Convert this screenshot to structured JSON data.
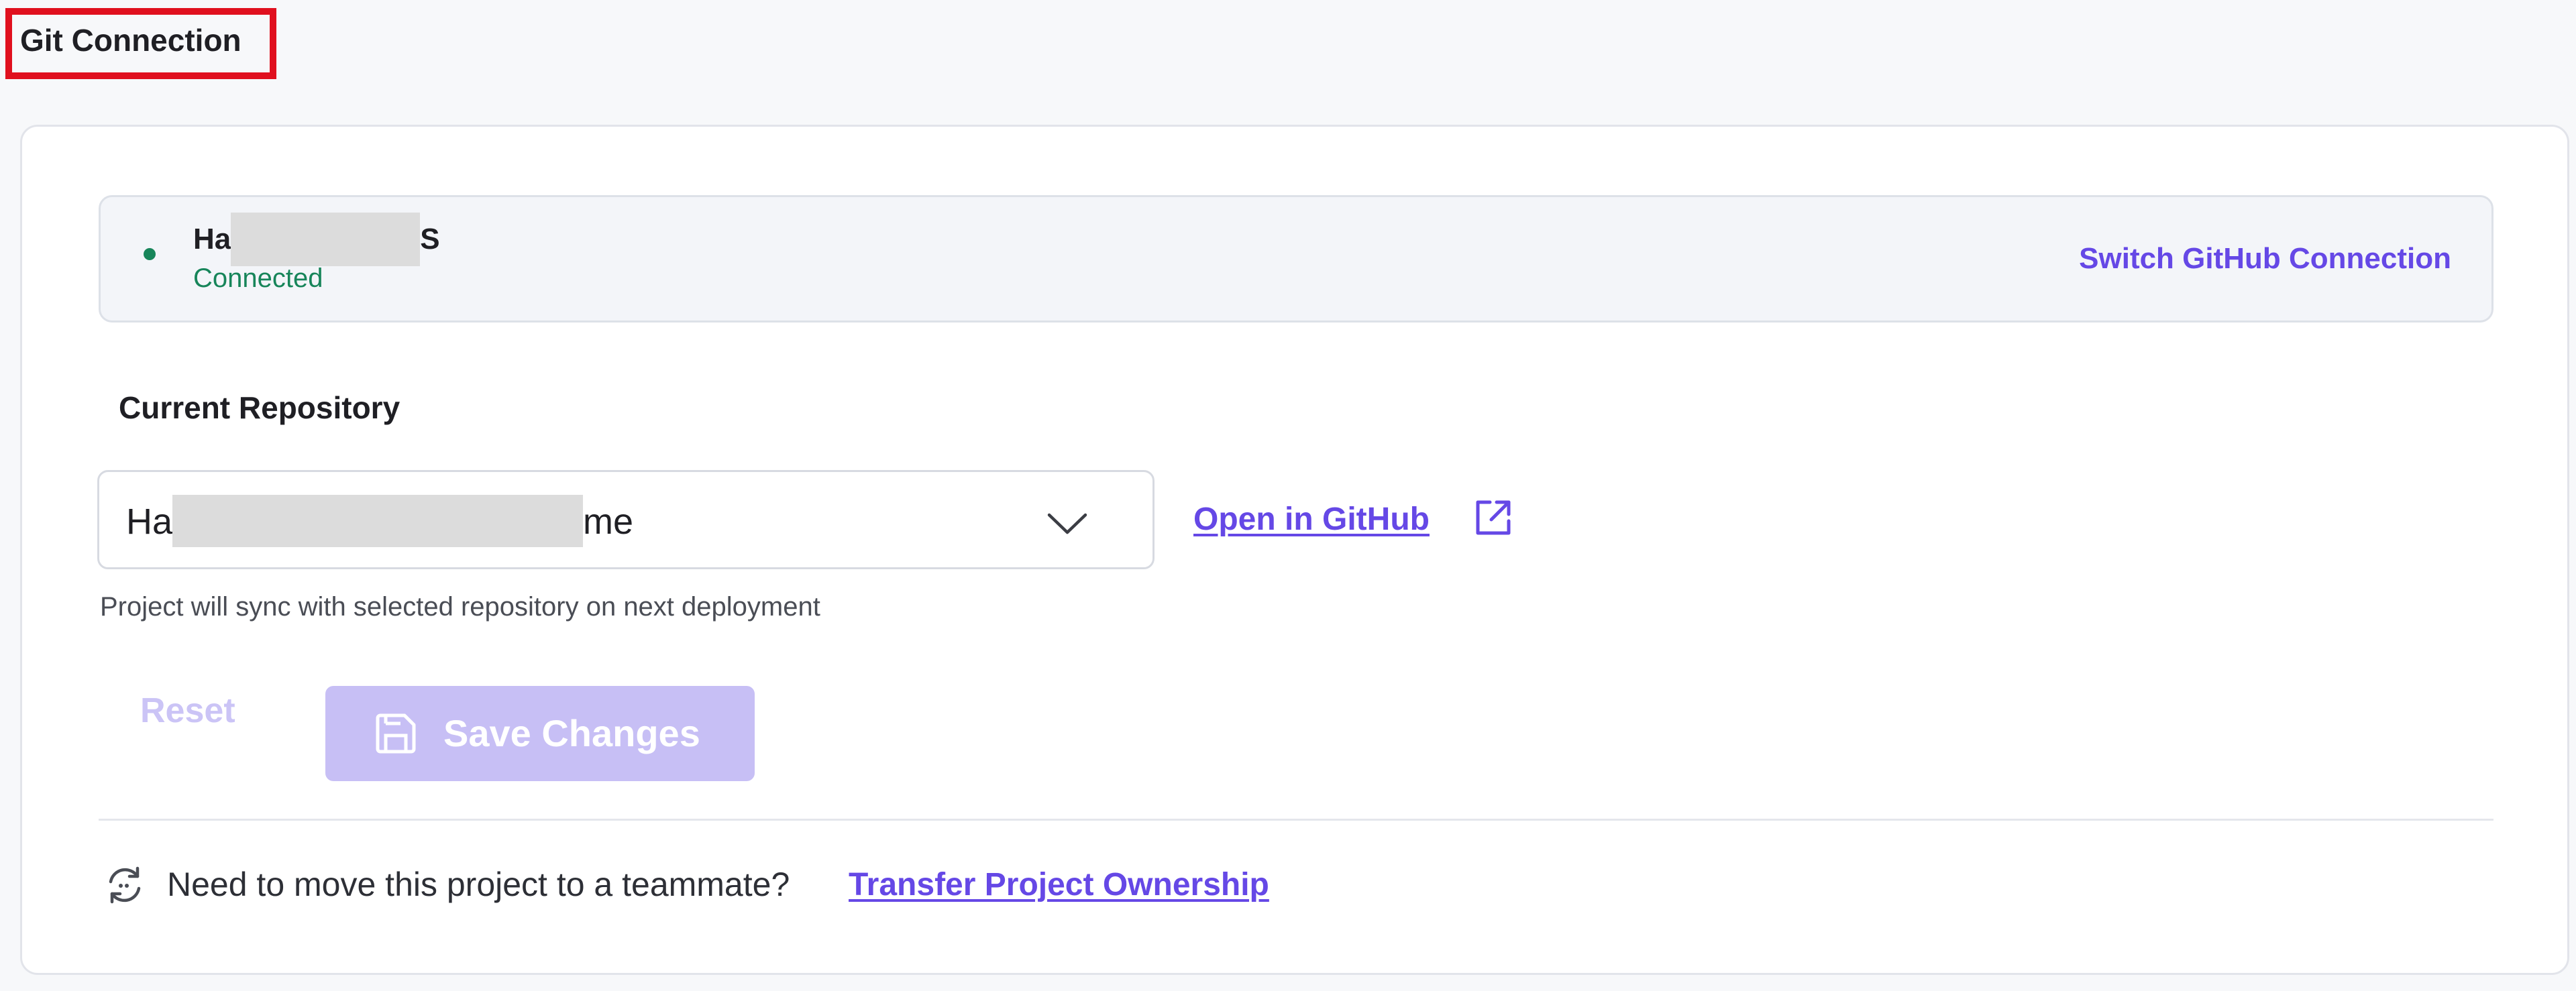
{
  "section": {
    "title": "Git Connection"
  },
  "connection": {
    "account_prefix": "Ha",
    "account_suffix": "S",
    "status": "Connected",
    "status_color": "#17855a",
    "switch_label": "Switch GitHub Connection"
  },
  "repository": {
    "heading": "Current Repository",
    "selected_prefix": "Ha",
    "selected_suffix": "me",
    "open_link_label": "Open in GitHub",
    "sync_note": "Project will sync with selected repository on next deployment"
  },
  "actions": {
    "reset_label": "Reset",
    "save_label": "Save Changes",
    "disabled": true
  },
  "transfer": {
    "prompt": "Need to move this project to a teammate?",
    "link_label": "Transfer Project Ownership"
  },
  "colors": {
    "accent": "#6548e6",
    "accent_disabled": "#c7bff5",
    "annotation_box": "#e0101e"
  },
  "icons": {
    "status": "status-dot",
    "dropdown": "chevron-down-icon",
    "external": "external-link-icon",
    "save": "floppy-disk-icon",
    "transfer": "sync-arrows-icon"
  }
}
